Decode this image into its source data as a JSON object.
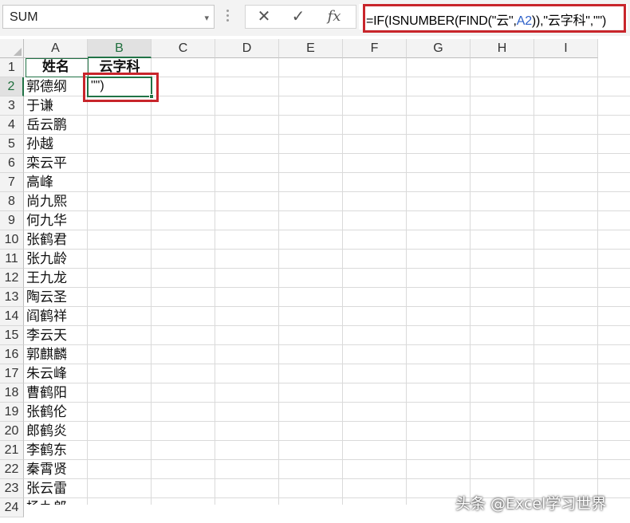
{
  "formula_bar": {
    "name_box": "SUM",
    "name_box_arrow": "▾",
    "cancel": "✕",
    "enter": "✓",
    "fx": "fx",
    "formula_parts": {
      "p1": "=IF(ISNUMBER(FIND(\"云\",",
      "ref": "A2",
      "p2": ")),\"云字科\",\"\")"
    }
  },
  "columns": [
    "A",
    "B",
    "C",
    "D",
    "E",
    "F",
    "G",
    "H",
    "I"
  ],
  "rows": [
    "1",
    "2",
    "3",
    "4",
    "5",
    "6",
    "7",
    "8",
    "9",
    "10",
    "11",
    "12",
    "13",
    "14",
    "15",
    "16",
    "17",
    "18",
    "19",
    "20",
    "21",
    "22",
    "23",
    "24"
  ],
  "sheet": {
    "A1": "姓名",
    "B1": "云字科",
    "B2_editing": "\"\")",
    "names": [
      "郭德纲",
      "于谦",
      "岳云鹏",
      "孙越",
      "栾云平",
      "高峰",
      "尚九熙",
      "何九华",
      "张鹤君",
      "张九龄",
      "王九龙",
      "陶云圣",
      "阎鹤祥",
      "李云天",
      "郭麒麟",
      "朱云峰",
      "曹鹤阳",
      "张鹤伦",
      "郎鹤炎",
      "李鹤东",
      "秦霄贤",
      "张云雷",
      "杨九郎"
    ]
  },
  "selection": {
    "active_cell": "B2",
    "active_column": "B",
    "active_row": "2"
  },
  "highlight_color": "#c8252b",
  "selection_color": "#217346",
  "watermark": "头条 @Excel学习世界"
}
